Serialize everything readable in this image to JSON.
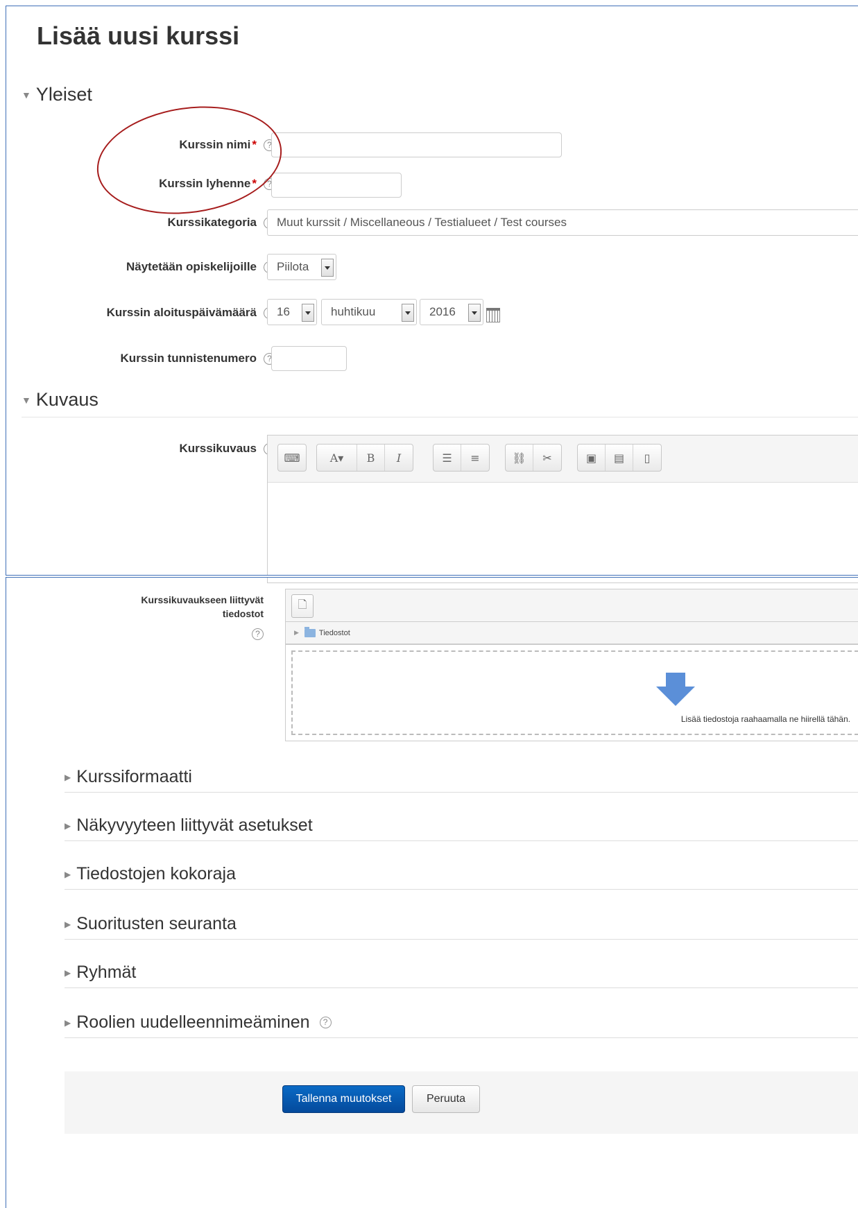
{
  "page": {
    "title": "Lisää uusi kurssi"
  },
  "sections": {
    "general": "Yleiset",
    "description": "Kuvaus"
  },
  "fields": {
    "fullname": {
      "label": "Kurssin nimi",
      "required_mark": "*",
      "value": ""
    },
    "shortname": {
      "label": "Kurssin lyhenne",
      "required_mark": "*",
      "value": ""
    },
    "category": {
      "label": "Kurssikategoria",
      "value": "Muut kurssit / Miscellaneous / Testialueet / Test courses"
    },
    "visible": {
      "label": "Näytetään opiskelijoille",
      "value": "Piilota"
    },
    "startdate": {
      "label": "Kurssin aloituspäivämäärä",
      "day": "16",
      "month": "huhtikuu",
      "year": "2016"
    },
    "idnumber": {
      "label": "Kurssin tunnistenumero",
      "value": ""
    },
    "summary": {
      "label": "Kurssikuvaus"
    },
    "summary_files": {
      "label_line1": "Kurssikuvaukseen liittyvät",
      "label_line2": "tiedostot",
      "folder": "Tiedostot",
      "drop_hint": "Lisää tiedostoja raahaamalla ne hiirellä tähän."
    }
  },
  "help_icon_glyph": "?",
  "collapsed_sections": [
    "Kurssiformaatti",
    "Näkyvyyteen liittyvät asetukset",
    "Tiedostojen kokoraja",
    "Suoritusten seuranta",
    "Ryhmät",
    "Roolien uudelleennimeäminen"
  ],
  "buttons": {
    "save": "Tallenna muutokset",
    "cancel": "Peruuta"
  },
  "colors": {
    "primary": "#0a5fb4",
    "required": "#cc0000",
    "annotation": "#a61c1c",
    "frame": "#3f6fb7"
  }
}
